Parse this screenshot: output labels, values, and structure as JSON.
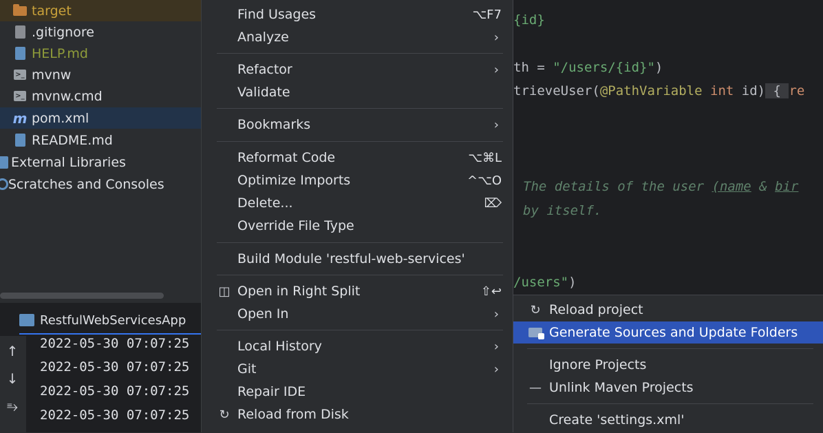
{
  "project_tree": {
    "items": [
      {
        "label": "target",
        "icon": "folder-icon",
        "color": "#c9a13a"
      },
      {
        "label": ".gitignore",
        "icon": "file-icon",
        "color": "#dfe1e5"
      },
      {
        "label": "HELP.md",
        "icon": "markdown-file-icon",
        "color": "#8f9c3a"
      },
      {
        "label": "mvnw",
        "icon": "terminal-file-icon",
        "color": "#dfe1e5"
      },
      {
        "label": "mvnw.cmd",
        "icon": "terminal-file-icon",
        "color": "#dfe1e5"
      },
      {
        "label": "pom.xml",
        "icon": "maven-icon",
        "color": "#dfe1e5"
      },
      {
        "label": "README.md",
        "icon": "markdown-file-icon",
        "color": "#dfe1e5"
      },
      {
        "label": "External Libraries",
        "icon": "library-icon",
        "color": "#dfe1e5"
      },
      {
        "label": "Scratches and Consoles",
        "icon": "scratches-icon",
        "color": "#dfe1e5"
      }
    ]
  },
  "run_panel": {
    "tab_label": "RestfulWebServicesApp",
    "log_lines": [
      "2022-05-30 07:07:25",
      "2022-05-30 07:07:25",
      "2022-05-30 07:07:25",
      "2022-05-30 07:07:25"
    ],
    "tool_icons": [
      "arrow-up-icon",
      "arrow-down-icon",
      "soft-wrap-icon"
    ]
  },
  "editor": {
    "line1": "{id}",
    "line2_prefix": "th = ",
    "line2_string": "\"/users/{id}\"",
    "line2_suffix": ")",
    "line3_method": "trieveUser(",
    "line3_annotation": "@PathVariable",
    "line3_keyword": "int",
    "line3_param": " id)",
    "line3_brace": " { ",
    "line3_tail": "re",
    "comment1_a": "The details of the user ",
    "comment1_b": "(name",
    "comment1_c": " & ",
    "comment1_d": "bir",
    "comment2": "by itself.",
    "line4_string": "/users\"",
    "line4_suffix": ")"
  },
  "context_menu": {
    "items": [
      {
        "label": "Find Usages",
        "shortcut": "⌥F7"
      },
      {
        "label": "Analyze",
        "arrow": "›"
      },
      {
        "label": "Refactor",
        "arrow": "›"
      },
      {
        "label": "Validate"
      },
      {
        "label": "Bookmarks",
        "arrow": "›"
      },
      {
        "label": "Reformat Code",
        "shortcut": "⌥⌘L"
      },
      {
        "label": "Optimize Imports",
        "shortcut": "^⌥O"
      },
      {
        "label": "Delete...",
        "shortcut": "⌦"
      },
      {
        "label": "Override File Type"
      },
      {
        "label": "Build Module 'restful-web-services'"
      },
      {
        "label": "Open in Right Split",
        "icon": "split-view-icon",
        "shortcut": "⇧↩"
      },
      {
        "label": "Open In",
        "arrow": "›"
      },
      {
        "label": "Local History",
        "arrow": "›"
      },
      {
        "label": "Git",
        "arrow": "›"
      },
      {
        "label": "Repair IDE"
      },
      {
        "label": "Reload from Disk",
        "icon": "reload-icon"
      }
    ]
  },
  "maven_submenu": {
    "items": [
      {
        "label": "Reload project",
        "icon": "reload-icon"
      },
      {
        "label": "Generate Sources and Update Folders",
        "icon": "generate-sources-icon",
        "highlighted": true
      },
      {
        "label": "Ignore Projects"
      },
      {
        "label": "Unlink Maven Projects",
        "icon": "minus-icon"
      },
      {
        "label": "Create 'settings.xml'"
      }
    ]
  },
  "colors": {
    "menu_bg": "#2b2d30",
    "editor_bg": "#1e1f22",
    "selection_blue": "#2e55b8",
    "tree_selection": "#223349"
  }
}
